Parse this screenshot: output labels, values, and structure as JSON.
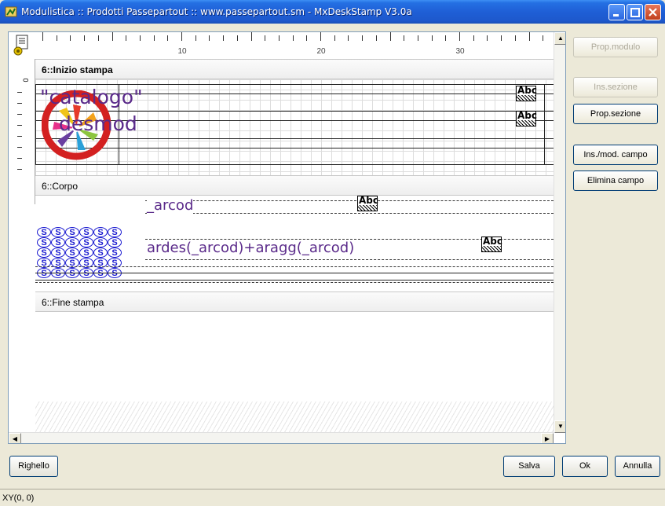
{
  "window": {
    "title": "Modulistica :: Prodotti Passepartout :: www.passepartout.sm - MxDeskStamp V3.0a"
  },
  "ruler": {
    "labels": [
      "10",
      "20",
      "30"
    ],
    "vertical_zero": "0"
  },
  "sections": [
    {
      "label": "6::Inizio stampa"
    },
    {
      "label": "6::Corpo"
    },
    {
      "label": "6::Fine stampa"
    }
  ],
  "fields": {
    "catalogo": "\"catalogo\"",
    "desmod": "desmod",
    "arcod": "_arcod",
    "ardes": "ardes(_arcod)+aragg(_arcod)",
    "abc": "Abc"
  },
  "s_grid": {
    "glyph": "S",
    "rows": 5,
    "cols": 6
  },
  "side_buttons": [
    {
      "label": "Prop.modulo",
      "enabled": false
    },
    {
      "label": "Ins.sezione",
      "enabled": false
    },
    {
      "label": "Prop.sezione",
      "enabled": true
    },
    {
      "label": "Ins./mod. campo",
      "enabled": true
    },
    {
      "label": "Elimina campo",
      "enabled": true
    }
  ],
  "bottom_buttons": {
    "righello": "Righello",
    "salva": "Salva",
    "ok": "Ok",
    "annulla": "Annulla"
  },
  "status": {
    "coords": "XY(0, 0)"
  },
  "colors": {
    "titlebar": "#1f5fd6",
    "field_text": "#5a2a8a",
    "s_glyph": "#1a1ad0"
  }
}
